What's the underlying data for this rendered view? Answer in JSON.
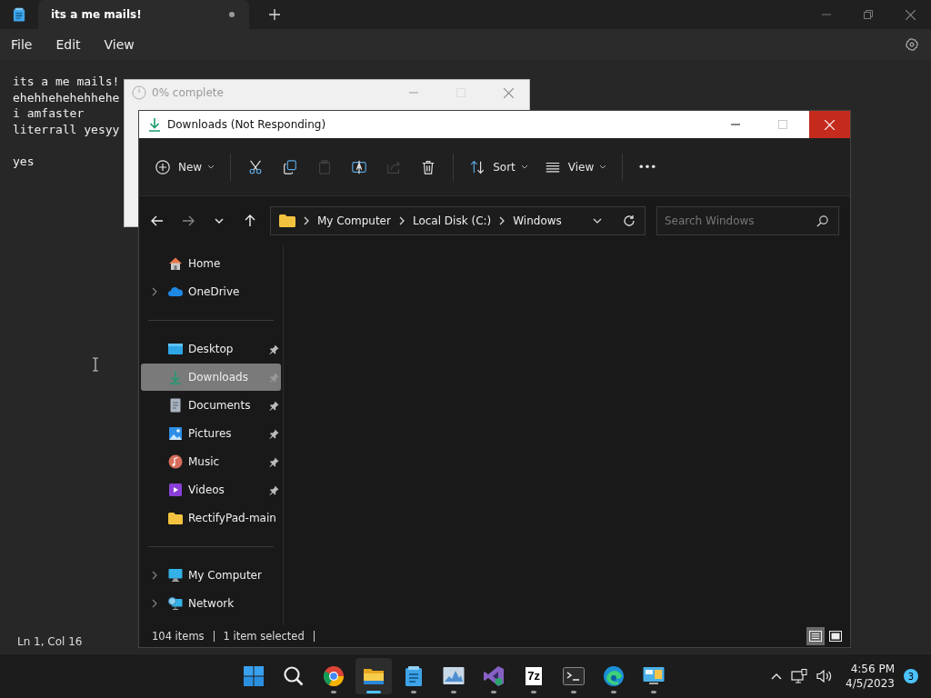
{
  "notepad": {
    "tab": {
      "title": "its a me mails!",
      "modified": true
    },
    "menu": [
      "File",
      "Edit",
      "View"
    ],
    "paragraphs": [
      [
        "its a me mails!",
        "ehehhehehehhehe",
        "i amfaster",
        "literrall yesyy"
      ],
      [
        "yes"
      ]
    ],
    "status": "Ln 1, Col 16"
  },
  "progress_dialog": {
    "title": "0% complete"
  },
  "explorer": {
    "title": "Downloads (Not Responding)",
    "toolbar": [
      [
        {
          "label": "New",
          "disabled": false
        }
      ],
      [
        {
          "disabled": false
        },
        {
          "disabled": false
        },
        {
          "disabled": true
        },
        {
          "disabled": false
        },
        {
          "disabled": true
        },
        {
          "disabled": false
        }
      ],
      [
        {
          "label": "Sort",
          "disabled": false
        },
        {
          "label": "View",
          "disabled": false
        }
      ],
      [
        {
          "disabled": false
        }
      ]
    ],
    "nav": [
      {
        "disabled": false
      },
      {
        "disabled": true
      },
      {
        "disabled": false
      },
      {
        "disabled": false
      }
    ],
    "address": [
      "My Computer",
      "Local Disk (C:)",
      "Windows"
    ],
    "search": {
      "placeholder": "Search Windows"
    },
    "sidebar": [
      [
        {
          "label": "Home",
          "expandable": false,
          "pinned": false,
          "selected": false
        },
        {
          "label": "OneDrive",
          "expandable": true,
          "pinned": false,
          "selected": false
        }
      ],
      [
        {
          "label": "Desktop",
          "expandable": false,
          "pinned": true,
          "selected": false
        },
        {
          "label": "Downloads",
          "expandable": false,
          "pinned": true,
          "selected": true
        },
        {
          "label": "Documents",
          "expandable": false,
          "pinned": true,
          "selected": false
        },
        {
          "label": "Pictures",
          "expandable": false,
          "pinned": true,
          "selected": false
        },
        {
          "label": "Music",
          "expandable": false,
          "pinned": true,
          "selected": false
        },
        {
          "label": "Videos",
          "expandable": false,
          "pinned": true,
          "selected": false
        },
        {
          "label": "RectifyPad-main",
          "expandable": false,
          "pinned": false,
          "selected": false
        }
      ],
      [
        {
          "label": "My Computer",
          "expandable": true,
          "pinned": false,
          "selected": false
        },
        {
          "label": "Network",
          "expandable": true,
          "pinned": false,
          "selected": false
        }
      ]
    ],
    "status": {
      "count": "104 items",
      "selection": "1 item selected"
    },
    "views": [
      {
        "selected": true
      },
      {
        "selected": false
      }
    ]
  },
  "taskbar": {
    "apps": [
      {
        "running": false,
        "active": false
      },
      {
        "running": false,
        "active": false
      },
      {
        "running": true,
        "active": false
      },
      {
        "running": true,
        "active": true
      },
      {
        "running": true,
        "active": false
      },
      {
        "running": true,
        "active": false
      },
      {
        "running": true,
        "active": false
      },
      {
        "label": "7z",
        "running": true,
        "active": false
      },
      {
        "running": true,
        "active": false
      },
      {
        "running": true,
        "active": false
      },
      {
        "running": true,
        "active": false
      }
    ],
    "time": "4:56 PM",
    "date": "4/5/2023",
    "notifications": "3"
  }
}
